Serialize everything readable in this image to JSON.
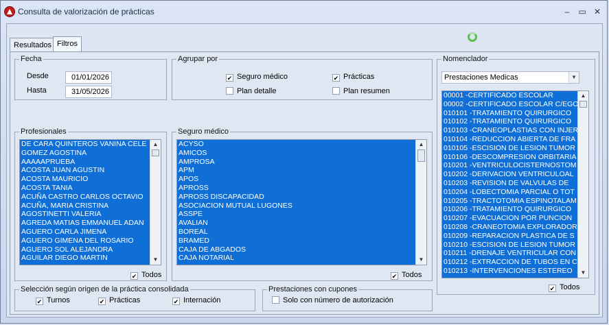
{
  "window": {
    "title": "Consulta de valorización de prácticas",
    "minimize": "–",
    "maximize": "▭",
    "close": "✕"
  },
  "tabs": [
    {
      "label": "Resultados"
    },
    {
      "label": "Filtros"
    }
  ],
  "fecha": {
    "legend": "Fecha",
    "desde_label": "Desde",
    "desde_value": "01/01/2026",
    "hasta_label": "Hasta",
    "hasta_value": "31/05/2026"
  },
  "agrupar": {
    "legend": "Agrupar por",
    "seguro_medico": "Seguro médico",
    "practicas": "Prácticas",
    "plan_detalle": "Plan detalle",
    "plan_resumen": "Plan resumen"
  },
  "profesionales": {
    "legend": "Profesionales",
    "todos": "Todos",
    "items": [
      "DE CARA QUINTEROS VANINA CELE",
      "GOMEZ AGOSTINA",
      "AAAAAPRUEBA",
      "ACOSTA JUAN AGUSTIN",
      "ACOSTA MAURICIO",
      "ACOSTA TANIA",
      "ACUÑA CASTRO CARLOS OCTAVIO",
      "ACUÑA, MARIA CRISTINA",
      "AGOSTINETTI VALERIA",
      "AGREDA MATIAS EMMANUEL ADAN",
      "AGUERO CARLA JIMENA",
      "AGUERO GIMENA DEL ROSARIO",
      "AGUERO SOL ALEJANDRA",
      "AGUILAR DIEGO MARTIN"
    ]
  },
  "seguro": {
    "legend": "Seguro médico",
    "todos": "Todos",
    "items": [
      "ACYSO",
      "AMICOS",
      "AMPROSA",
      "APM",
      "APOS",
      "APROSS",
      "APROSS DISCAPACIDAD",
      "ASOCIACION MUTUAL LUGONES",
      "ASSPE",
      "AVALIAN",
      "BOREAL",
      "BRAMED",
      "CAJA DE ABGADOS",
      "CAJA NOTARIAL"
    ]
  },
  "nomenclador": {
    "legend": "Nomenclador",
    "selected": "Prestaciones Medicas",
    "todos": "Todos",
    "items": [
      "00001 -CERTIFICADO ESCOLAR",
      "00002 -CERTIFICADO ESCOLAR C/EGO",
      "010101 -TRATAMIENTO QUIRURGICO",
      "010102 -TRATAMIENTO QUIRURGICO",
      "010103 -CRANEOPLASTIAS CON INJER",
      "010104 -REDUCCION ABIERTA DE FRA",
      "010105 -ESCISION DE LESION TUMOR",
      "010106 -DESCOMPRESION ORBITARIA",
      "010201 -VENTRICULOCISTERNOSTOM",
      "010202 -DERIVACION VENTRICULOAL",
      "010203 -REVISION DE VALVULAS DE",
      "010204 -LOBECTOMIA PARCIAL O TOT",
      "010205 -TRACTOTOMIA ESPINOTALAM",
      "010206 -TRATAMIENTO QUIRURGICO",
      "010207 -EVACUACION POR PUNCION",
      "010208 -CRANEOTOMIA EXPLORADOR",
      "010209 -REPARACION PLASTICA DE S",
      "010210 -ESCISION DE LESION TUMOR",
      "010211 -DRENAJE VENTRICULAR CON",
      "010212 -EXTRACCION DE TUBOS EN C",
      "010213 -INTERVENCIONES ESTEREO"
    ]
  },
  "origen": {
    "legend": "Selección según origen de la práctica consolidada",
    "turnos": "Turnos",
    "practicas": "Prácticas",
    "internacion": "Internación"
  },
  "cupones": {
    "legend": "Prestaciones con cupones",
    "solo": "Solo con número de autorización"
  }
}
